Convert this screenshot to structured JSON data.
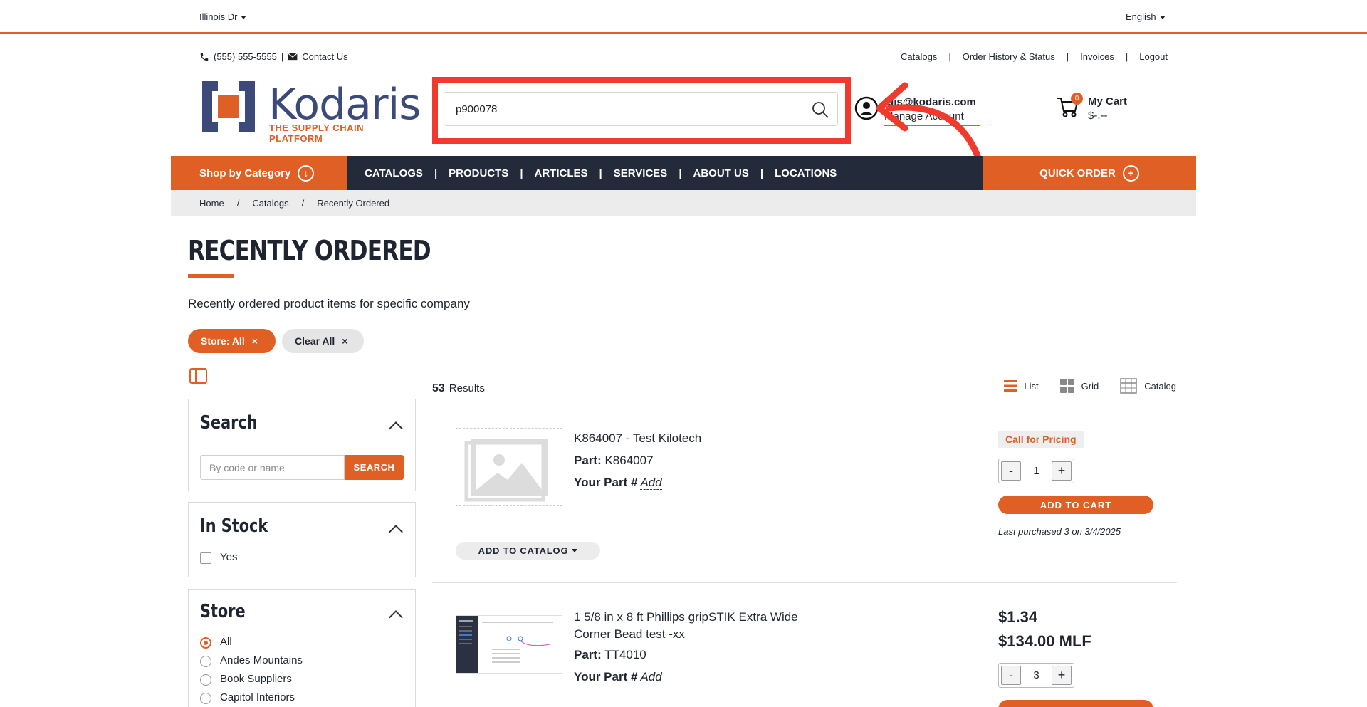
{
  "top": {
    "location": "Illinois Dr",
    "language": "English"
  },
  "util": {
    "phone": "(555) 555-5555",
    "divider": "|",
    "contact": "Contact Us",
    "links": [
      "Catalogs",
      "Order History & Status",
      "Invoices",
      "Logout"
    ]
  },
  "brand": {
    "name": "Kodaris",
    "tagline": "THE SUPPLY CHAIN PLATFORM",
    "accent": "#e05f24",
    "navy": "#232b3a"
  },
  "search": {
    "value": "p900078"
  },
  "account": {
    "email": "luis@kodaris.com",
    "manage": "Manage Account"
  },
  "cart": {
    "count": "0",
    "label": "My Cart",
    "amount": "$-.--"
  },
  "nav": {
    "shop": "Shop by Category",
    "links": [
      "CATALOGS",
      "PRODUCTS",
      "ARTICLES",
      "SERVICES",
      "ABOUT US",
      "LOCATIONS"
    ],
    "sep": "|",
    "quick": "QUICK ORDER"
  },
  "breadcrumbs": [
    "Home",
    "Catalogs",
    "Recently Ordered"
  ],
  "breadcrumb_sep": "/",
  "page": {
    "title": "RECENTLY ORDERED",
    "subtitle": "Recently ordered product items for specific company"
  },
  "chips": {
    "store": "Store: All",
    "clear": "Clear All",
    "x": "×"
  },
  "filters": {
    "search_title": "Search",
    "search_placeholder": "By code or name",
    "search_button": "SEARCH",
    "stock_title": "In Stock",
    "stock_yes": "Yes",
    "store_title": "Store",
    "stores": [
      "All",
      "Andes Mountains",
      "Book Suppliers",
      "Capitol Interiors"
    ]
  },
  "results": {
    "count": "53",
    "label": "Results"
  },
  "views": [
    "List",
    "Grid",
    "Catalog"
  ],
  "products": [
    {
      "name": "K864007 - Test Kilotech",
      "part_label": "Part:",
      "part": "K864007",
      "your_part_label": "Your Part #",
      "your_part_action": "Add",
      "pricing": "Call for Pricing",
      "qty": "1",
      "add_to_cart": "ADD TO CART",
      "last": "Last purchased 3 on 3/4/2025",
      "add_to_catalog": "ADD TO CATALOG"
    },
    {
      "name_line1": "1 5/8 in x 8 ft Phillips gripSTIK Extra Wide",
      "name_line2": "Corner Bead test -xx",
      "part_label": "Part:",
      "part": "TT4010",
      "your_part_label": "Your Part #",
      "your_part_action": "Add",
      "price": "$1.34",
      "price_unit": "$134.00 MLF",
      "qty": "3"
    }
  ],
  "qty_buttons": {
    "minus": "-",
    "plus": "+"
  }
}
